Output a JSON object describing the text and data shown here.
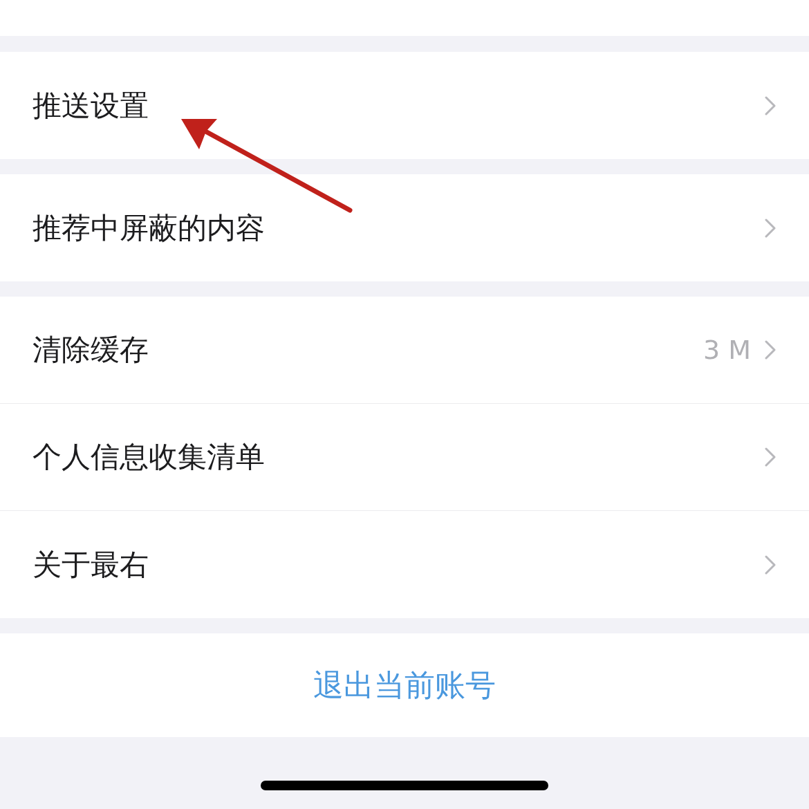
{
  "groups": [
    {
      "items": [
        {
          "label": "推送设置"
        }
      ]
    },
    {
      "items": [
        {
          "label": "推荐中屏蔽的内容"
        }
      ]
    },
    {
      "items": [
        {
          "label": "清除缓存",
          "value": "3 M"
        },
        {
          "label": "个人信息收集清单"
        },
        {
          "label": "关于最右"
        }
      ]
    }
  ],
  "logout": "退出当前账号"
}
